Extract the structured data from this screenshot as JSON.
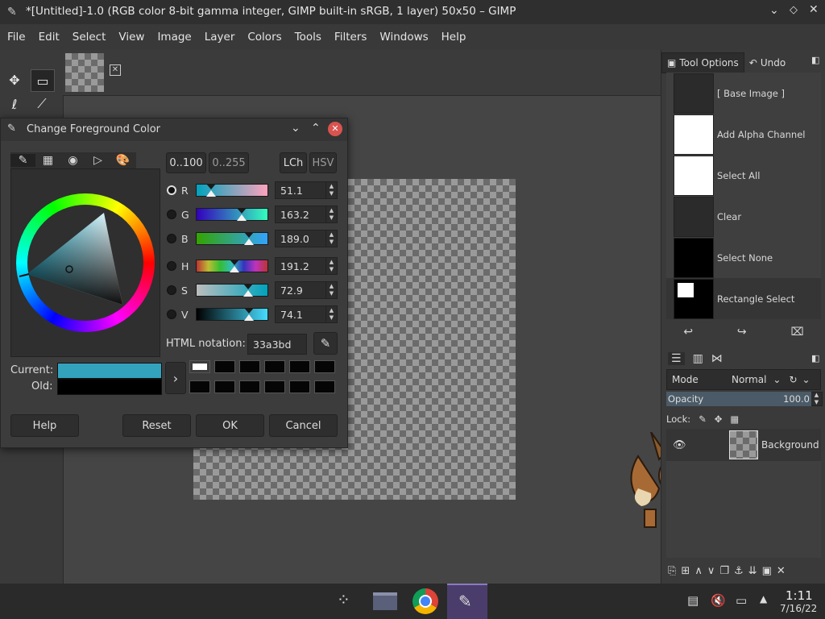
{
  "window": {
    "title": "*[Untitled]-1.0 (RGB color 8-bit gamma integer, GIMP built-in sRGB, 1 layer) 50x50 – GIMP"
  },
  "menu": [
    "File",
    "Edit",
    "Select",
    "View",
    "Image",
    "Layer",
    "Colors",
    "Tools",
    "Filters",
    "Windows",
    "Help"
  ],
  "dialog": {
    "title": "Change Foreground Color",
    "range_buttons": [
      "0..100",
      "0..255"
    ],
    "model_buttons": [
      "LCh",
      "HSV"
    ],
    "channels": [
      {
        "label": "R",
        "value": "51.1",
        "fraction": 0.201
      },
      {
        "label": "G",
        "value": "163.2",
        "fraction": 0.64
      },
      {
        "label": "B",
        "value": "189.0",
        "fraction": 0.741
      },
      {
        "label": "H",
        "value": "191.2",
        "fraction": 0.531
      },
      {
        "label": "S",
        "value": "72.9",
        "fraction": 0.729
      },
      {
        "label": "V",
        "value": "74.1",
        "fraction": 0.741
      }
    ],
    "html_label": "HTML notation:",
    "html_value": "33a3bd",
    "current_label": "Current:",
    "old_label": "Old:",
    "current_color": "#33a3bd",
    "old_color": "#000000",
    "buttons": {
      "help": "Help",
      "reset": "Reset",
      "ok": "OK",
      "cancel": "Cancel"
    }
  },
  "dock": {
    "tabs": {
      "tool_options": "Tool Options",
      "undo": "Undo"
    },
    "undo_history": [
      {
        "label": "[ Base Image ]",
        "thumb": "#2b2b2b"
      },
      {
        "label": "Add Alpha Channel",
        "thumb": "#ffffff"
      },
      {
        "label": "Select All",
        "thumb": "#ffffff"
      },
      {
        "label": "Clear",
        "thumb": "#2b2b2b"
      },
      {
        "label": "Select None",
        "thumb": "#000000"
      },
      {
        "label": "Rectangle Select",
        "thumb": "#000000"
      }
    ],
    "layers": {
      "mode_label": "Mode",
      "mode_value": "Normal",
      "opacity_label": "Opacity",
      "opacity_value": "100.0",
      "lock_label": "Lock:",
      "layer_name": "Background"
    }
  },
  "taskbar": {
    "time": "1:11",
    "date": "7/16/22"
  }
}
